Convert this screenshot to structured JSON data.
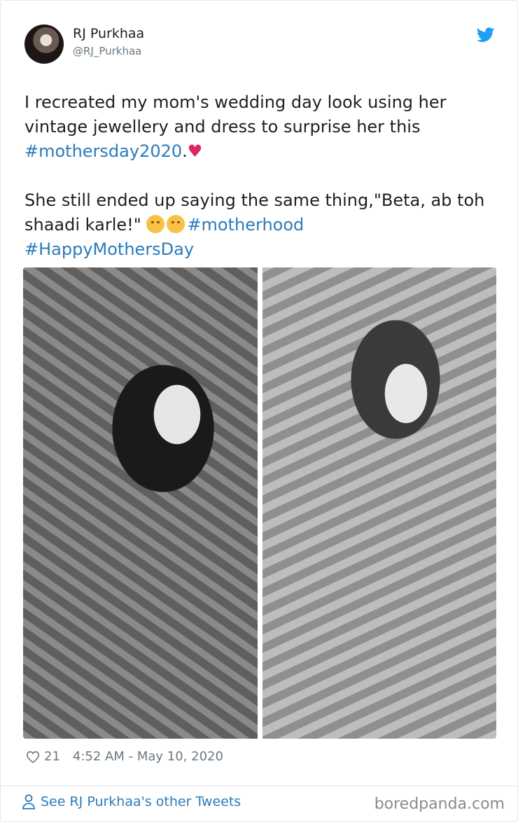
{
  "tweet": {
    "author_name": "RJ Purkhaa",
    "author_handle": "@RJ_Purkhaa",
    "text_line1": "I recreated my mom's wedding day look using her vintage jewellery and dress to surprise her this ",
    "hashtag1": "#mothersday2020",
    "text_after_hashtag1": ".",
    "heart_emoji": "♥",
    "text_para2": "She still ended up saying the same thing,\"Beta, ab toh shaadi karle!\" ",
    "hashtag2": "#motherhood",
    "hashtag3": "#HappyMothersDay",
    "likes": "21",
    "timestamp": "4:52 AM - May 10, 2020",
    "other_tweets_link": "See RJ Purkhaa's other Tweets",
    "icons": [
      "twitter-bird-icon",
      "heart-outline-icon",
      "person-icon"
    ]
  },
  "photos": {
    "left_alt": "mother wedding photo",
    "right_alt": "recreated wedding look photo"
  },
  "watermark": "boredpanda.com",
  "colors": {
    "link": "#2b7bb9",
    "muted": "#697882",
    "heart": "#e0245e",
    "twitter_blue": "#1da1f2"
  }
}
